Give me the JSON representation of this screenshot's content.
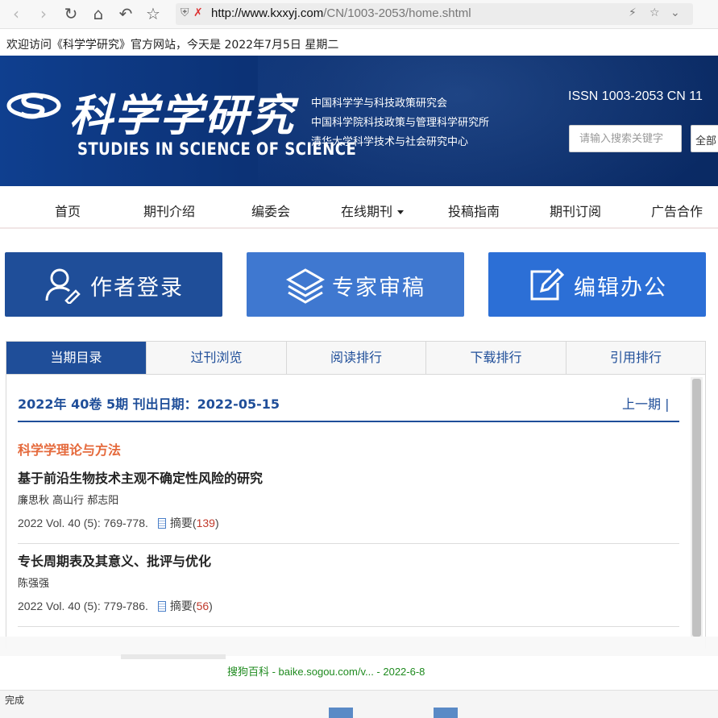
{
  "browser": {
    "url_host": "http://www.kxxyj.com",
    "url_path": "/CN/1003-2053/home.shtml"
  },
  "welcome_text": "欢迎访问《科学学研究》官方网站，今天是 2022年7月5日 星期二",
  "header": {
    "logo_title": "科学学研究",
    "logo_en": "STUDIES IN SCIENCE OF SCIENCE",
    "orgs": [
      "中国科学学与科技政策研究会",
      "中国科学院科技政策与管理科学研究所",
      "清华大学科学技术与社会研究中心"
    ],
    "issn": "ISSN 1003-2053   CN 11",
    "search_placeholder": "请输入搜索关键字",
    "search_scope": "全部"
  },
  "nav": [
    "首页",
    "期刊介绍",
    "编委会",
    "在线期刊",
    "投稿指南",
    "期刊订阅",
    "广告合作"
  ],
  "quick_buttons": [
    {
      "label": "作者登录",
      "color": "#1f4e99"
    },
    {
      "label": "专家审稿",
      "color": "#3f78d0"
    },
    {
      "label": "编辑办公",
      "color": "#2c6fd6"
    }
  ],
  "tabs": [
    "当期目录",
    "过刊浏览",
    "阅读排行",
    "下载排行",
    "引用排行"
  ],
  "issue": {
    "heading": "2022年 40卷 5期  刊出日期：2022-05-15",
    "prev": "上一期  |"
  },
  "section_title": "科学学理论与方法",
  "articles": [
    {
      "title": "基于前沿生物技术主观不确定性风险的研究",
      "authors": "廉思秋 高山行 郝志阳",
      "citation": "2022 Vol. 40 (5): 769-778.",
      "abstract_label": "摘要",
      "abstract_count": "139"
    },
    {
      "title": "专长周期表及其意义、批评与优化",
      "authors": "陈强强",
      "citation": "2022 Vol. 40 (5): 779-786.",
      "abstract_label": "摘要",
      "abstract_count": "56"
    }
  ],
  "overlay": {
    "sogou_source": "搜狗百科 - baike.sogou.com/v... - 2022-6-8"
  },
  "status": "完成"
}
